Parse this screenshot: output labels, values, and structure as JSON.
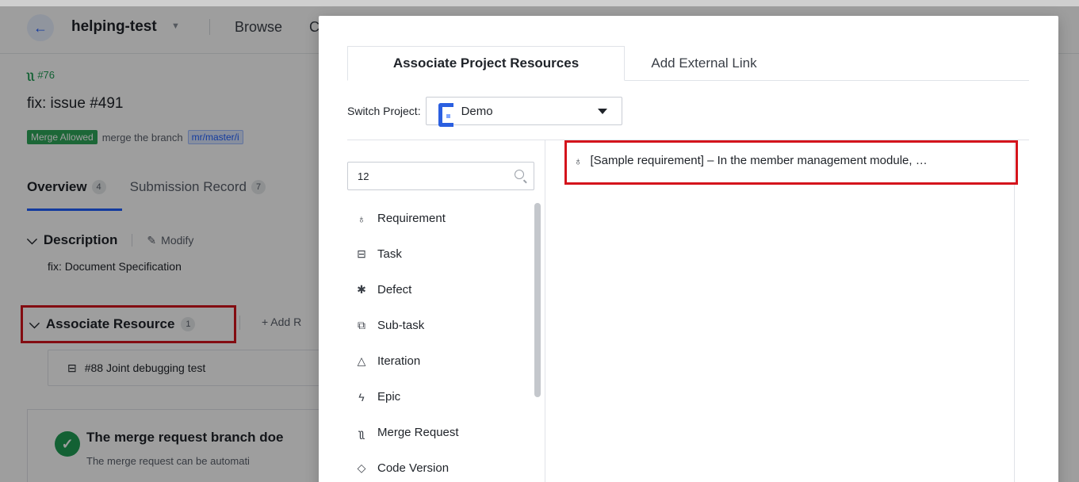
{
  "background": {
    "project_name": "helping-test",
    "nav_browse": "Browse",
    "nav_cut": "C",
    "mr_number": "#76",
    "mr_title": "fix: issue #491",
    "merge_status_badge": "Merge Allowed",
    "merge_text": "merge the branch",
    "branch_tag": "mr/master/i",
    "tabs": [
      {
        "label": "Overview",
        "count": "4"
      },
      {
        "label": "Submission Record",
        "count": "7"
      }
    ],
    "description_heading": "Description",
    "modify_label": "Modify",
    "description_text": "fix: Document Specification",
    "associate_heading": "Associate Resource",
    "associate_count": "1",
    "add_resource_label": "+ Add R",
    "resource_item": "#88 Joint debugging test",
    "merge_box_title": "The merge request branch doe",
    "merge_box_sub": "The merge request can be automati"
  },
  "modal": {
    "tabs": [
      {
        "label": "Associate Project Resources",
        "active": true
      },
      {
        "label": "Add External Link",
        "active": false
      }
    ],
    "switch_project_label": "Switch Project:",
    "selected_project": "Demo",
    "search_value": "12",
    "categories": [
      {
        "label": "Requirement",
        "icon": "bulb-icon"
      },
      {
        "label": "Task",
        "icon": "task-icon"
      },
      {
        "label": "Defect",
        "icon": "bug-icon"
      },
      {
        "label": "Sub-task",
        "icon": "subtask-icon"
      },
      {
        "label": "Iteration",
        "icon": "iteration-icon"
      },
      {
        "label": "Epic",
        "icon": "epic-icon"
      },
      {
        "label": "Merge Request",
        "icon": "merge-request-icon"
      },
      {
        "label": "Code Version",
        "icon": "tag-icon"
      }
    ],
    "result_item": "[Sample requirement] – In the member management module, …"
  }
}
